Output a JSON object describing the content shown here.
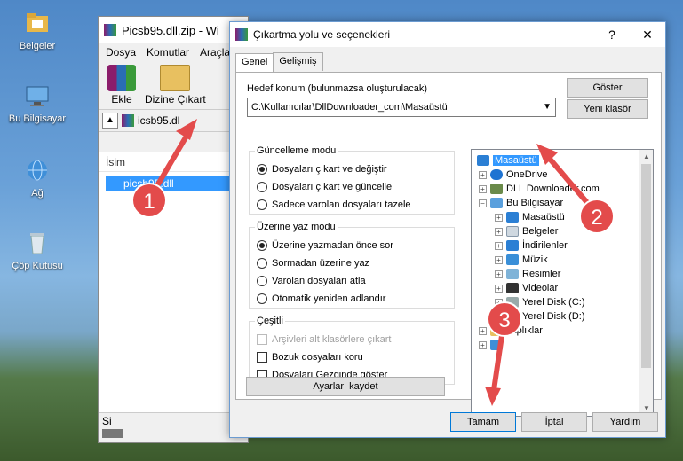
{
  "desktop": {
    "icons": [
      {
        "label": "Belgeler",
        "icon": "folder-icon"
      },
      {
        "label": "Bu Bilgisayar",
        "icon": "computer-icon"
      },
      {
        "label": "Ağ",
        "icon": "network-icon"
      },
      {
        "label": "Çöp Kutusu",
        "icon": "recycle-bin-icon"
      }
    ]
  },
  "winrar": {
    "title": "Picsb95.dll.zip - Wi",
    "menu": [
      "Dosya",
      "Komutlar",
      "Araçla"
    ],
    "toolbar": {
      "add_label": "Ekle",
      "extract_label": "Dizine Çıkart"
    },
    "address": "icsb95.dl",
    "column_name": "İsim",
    "file_row": "picsb95.dll",
    "status": "Si"
  },
  "dialog": {
    "title": "Çıkartma yolu ve seçenekleri",
    "help_button": "?",
    "close_button": "✕",
    "tabs": [
      "Genel",
      "Gelişmiş"
    ],
    "target_label": "Hedef konum (bulunmazsa oluşturulacak)",
    "target_value": "C:\\Kullanıcılar\\DllDownloader_com\\Masaüstü",
    "show_button": "Göster",
    "new_folder_button": "Yeni klasör",
    "update_mode": {
      "legend": "Güncelleme modu",
      "options": [
        "Dosyaları çıkart ve değiştir",
        "Dosyaları çıkart ve güncelle",
        "Sadece varolan dosyaları tazele"
      ],
      "selected_index": 0
    },
    "overwrite_mode": {
      "legend": "Üzerine yaz modu",
      "options": [
        "Üzerine yazmadan önce sor",
        "Sormadan üzerine yaz",
        "Varolan dosyaları atla",
        "Otomatik yeniden adlandır"
      ],
      "selected_index": 0
    },
    "misc": {
      "legend": "Çeşitli",
      "options": [
        "Arşivleri alt klasörlere çıkart",
        "Bozuk dosyaları koru",
        "Dosyaları Gezginde göster"
      ],
      "disabled_index": 0
    },
    "save_settings_button": "Ayarları kaydet",
    "tree": [
      {
        "label": "Masaüstü",
        "icon": "desktop-icon",
        "selected": true
      },
      {
        "label": "OneDrive",
        "icon": "cloud-icon"
      },
      {
        "label": "DLL Downloader.com",
        "icon": "user-icon"
      },
      {
        "label": "Bu Bilgisayar",
        "icon": "computer-icon"
      },
      {
        "label": "Masaüstü",
        "icon": "desktop-icon"
      },
      {
        "label": "Belgeler",
        "icon": "documents-icon"
      },
      {
        "label": "İndirilenler",
        "icon": "download-icon"
      },
      {
        "label": "Müzik",
        "icon": "music-icon"
      },
      {
        "label": "Resimler",
        "icon": "pictures-icon"
      },
      {
        "label": "Videolar",
        "icon": "videos-icon"
      },
      {
        "label": "Yerel Disk (C:)",
        "icon": "drive-icon"
      },
      {
        "label": "Yerel Disk (D:)",
        "icon": "drive-icon"
      },
      {
        "label": "ltaplıklar",
        "icon": "library-icon"
      },
      {
        "label": "Ağ",
        "icon": "network-icon"
      }
    ],
    "ok_button": "Tamam",
    "cancel_button": "İptal",
    "help_text_button": "Yardım"
  },
  "annotations": {
    "badge1": "1",
    "badge2": "2",
    "badge3": "3",
    "color": "#e34b4b"
  }
}
